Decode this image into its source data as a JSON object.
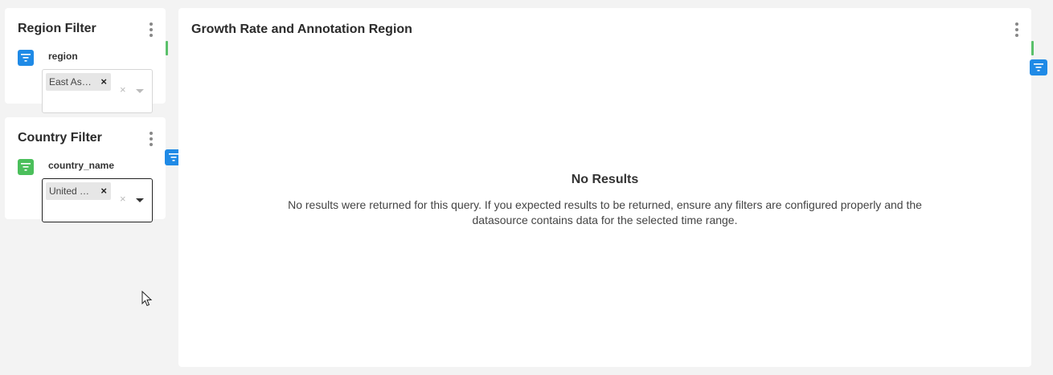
{
  "region_filter": {
    "title": "Region Filter",
    "field_label": "region",
    "selected_tag": "East As…",
    "tag_remove": "×",
    "clear": "×",
    "icon_color": "#1f8ae6"
  },
  "country_filter": {
    "title": "Country Filter",
    "field_label": "country_name",
    "selected_tag": "United …",
    "tag_remove": "×",
    "clear": "×",
    "icon_color": "#4bbf5b"
  },
  "chart_panel": {
    "title": "Growth Rate and Annotation Region",
    "no_results_title": "No Results",
    "no_results_message": "No results were returned for this query. If you expected results to be returned, ensure any filters are configured properly and the datasource contains data for the selected time range."
  },
  "colors": {
    "background": "#f3f3f3",
    "card": "#ffffff",
    "filter_blue": "#1f8ae6",
    "filter_green": "#4bbf5b"
  },
  "icons": [
    "kebab-menu-icon",
    "filter-icon",
    "chevron-down-icon",
    "close-icon",
    "mouse-cursor-icon"
  ]
}
